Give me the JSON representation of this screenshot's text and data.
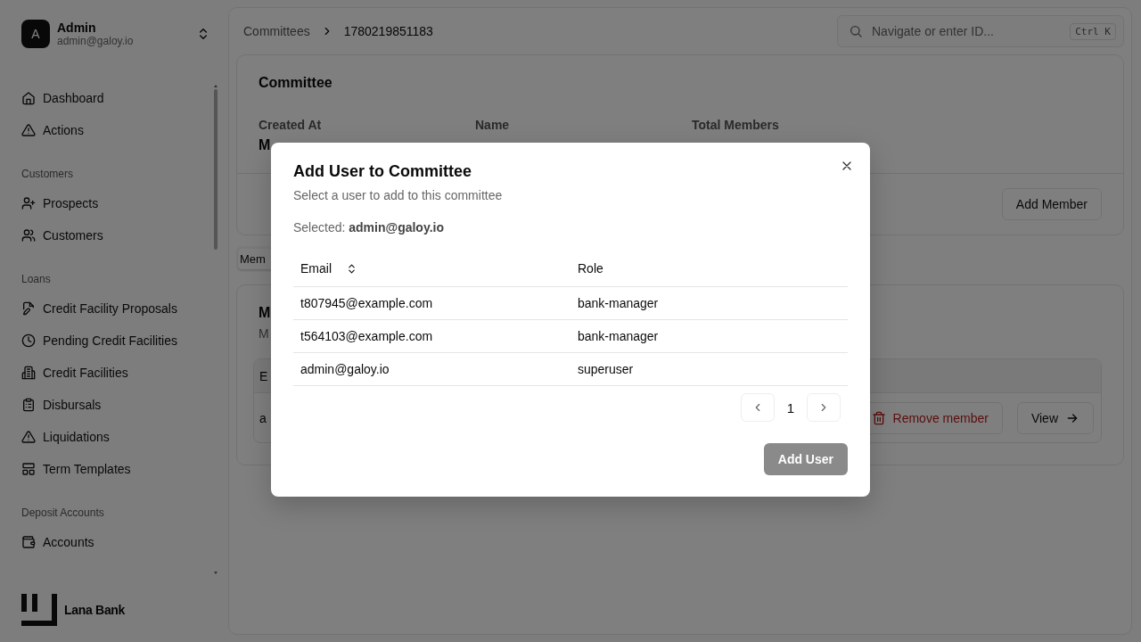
{
  "user": {
    "avatar": "A",
    "name": "Admin",
    "email": "admin@galoy.io"
  },
  "nav": [
    {
      "items": [
        {
          "label": "Dashboard"
        },
        {
          "label": "Actions"
        }
      ]
    },
    {
      "heading": "Customers",
      "items": [
        {
          "label": "Prospects"
        },
        {
          "label": "Customers"
        }
      ]
    },
    {
      "heading": "Loans",
      "items": [
        {
          "label": "Credit Facility Proposals"
        },
        {
          "label": "Pending Credit Facilities"
        },
        {
          "label": "Credit Facilities"
        },
        {
          "label": "Disbursals"
        },
        {
          "label": "Liquidations"
        },
        {
          "label": "Term Templates"
        }
      ]
    },
    {
      "heading": "Deposit Accounts",
      "items": [
        {
          "label": "Accounts"
        }
      ]
    }
  ],
  "brand": "Lana Bank",
  "breadcrumb": [
    "Committees",
    "1780219851183"
  ],
  "search": {
    "placeholder": "Navigate or enter ID...",
    "shortcut": "Ctrl K"
  },
  "committee_card": {
    "title": "Committee",
    "fields": [
      {
        "label": "Created At",
        "value": "M"
      },
      {
        "label": "Name"
      },
      {
        "label": "Total Members"
      }
    ],
    "action": "Add Member"
  },
  "tabs": [
    {
      "label": "Mem",
      "selected": true
    }
  ],
  "members_card": {
    "title": "M",
    "description": "M",
    "table": {
      "header": "E",
      "rows": [
        {
          "cell": "a",
          "remove": "Remove member",
          "view": "View"
        }
      ]
    }
  },
  "dialog": {
    "title": "Add User to Committee",
    "subtitle": "Select a user to add to this committee",
    "selected_label": "Selected:",
    "selected_value": "admin@galoy.io",
    "columns": [
      "Email",
      "Role"
    ],
    "rows": [
      {
        "email": "t807945@example.com",
        "role": "bank-manager"
      },
      {
        "email": "t564103@example.com",
        "role": "bank-manager"
      },
      {
        "email": "admin@galoy.io",
        "role": "superuser"
      }
    ],
    "page": "1",
    "submit": {
      "label": "Add User",
      "disabled": true
    }
  }
}
